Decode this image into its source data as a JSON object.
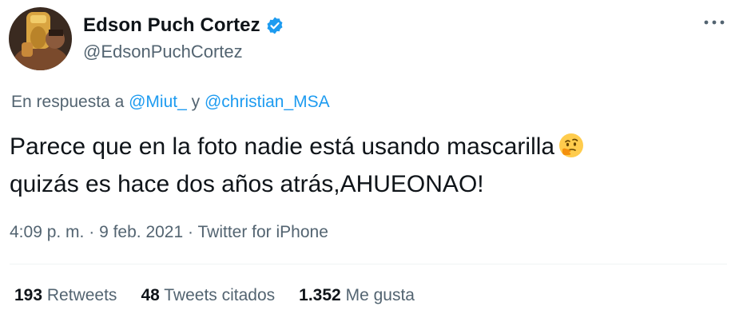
{
  "author": {
    "display_name": "Edson Puch Cortez",
    "handle": "@EdsonPuchCortez",
    "verified": true
  },
  "reply_context": {
    "prefix": "En respuesta a",
    "mention_1": "@Miut_",
    "conjunction": "y",
    "mention_2": "@christian_MSA"
  },
  "tweet": {
    "line_1": "Parece que en la foto nadie está usando mascarilla",
    "line_2": "quizás es hace dos años atrás,AHUEONAO!",
    "emoji": "thinking-face-emoji"
  },
  "meta": {
    "time": "4:09 p. m.",
    "date": "9 feb. 2021",
    "source": "Twitter for iPhone",
    "separator": "·"
  },
  "stats": {
    "retweets_count": "193",
    "retweets_label": "Retweets",
    "quotes_count": "48",
    "quotes_label": "Tweets citados",
    "likes_count": "1.352",
    "likes_label": "Me gusta"
  },
  "colors": {
    "accent": "#1d9bf0",
    "text_primary": "#0f1419",
    "text_secondary": "#536471"
  }
}
